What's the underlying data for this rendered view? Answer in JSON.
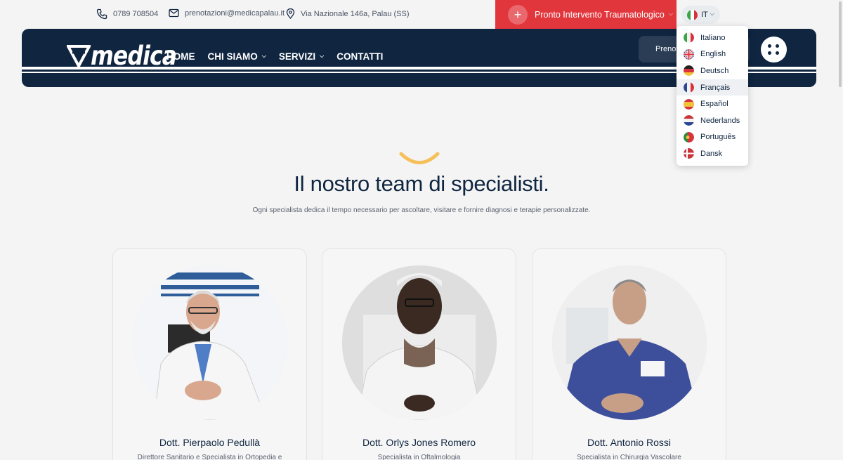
{
  "topbar": {
    "phone": "0789 708504",
    "email": "prenotazioni@medicapalau.it",
    "address": "Via Nazionale 146a, Palau (SS)",
    "emergency_label": "Pronto Intervento Traumatologico",
    "lang_current": "IT"
  },
  "nav": {
    "logo": "medica",
    "items": [
      {
        "label": "HOME"
      },
      {
        "label": "CHI SIAMO"
      },
      {
        "label": "SERVIZI"
      },
      {
        "label": "CONTATTI"
      }
    ],
    "book_label": "Prenot"
  },
  "languages": [
    {
      "label": "Italiano"
    },
    {
      "label": "English"
    },
    {
      "label": "Deutsch"
    },
    {
      "label": "Français"
    },
    {
      "label": "Español"
    },
    {
      "label": "Nederlands"
    },
    {
      "label": "Português"
    },
    {
      "label": "Dansk"
    }
  ],
  "section": {
    "title": "Il nostro team di specialisti.",
    "subtitle": "Ogni specialista dedica il tempo necessario per ascoltare, visitare e fornire diagnosi e terapie personalizzate."
  },
  "doctors": [
    {
      "name": "Dott. Pierpaolo Pedullà",
      "role": "Direttore Sanitario e Specialista in Ortopedia e"
    },
    {
      "name": "Dott. Orlys Jones Romero",
      "role": "Specialista in Oftalmologia"
    },
    {
      "name": "Dott. Antonio Rossi",
      "role": "Specialista in Chirurgia Vascolare"
    }
  ],
  "colors": {
    "navy": "#0f2540",
    "emergency_red": "#e2363d",
    "accent_yellow": "#f5c05a"
  }
}
